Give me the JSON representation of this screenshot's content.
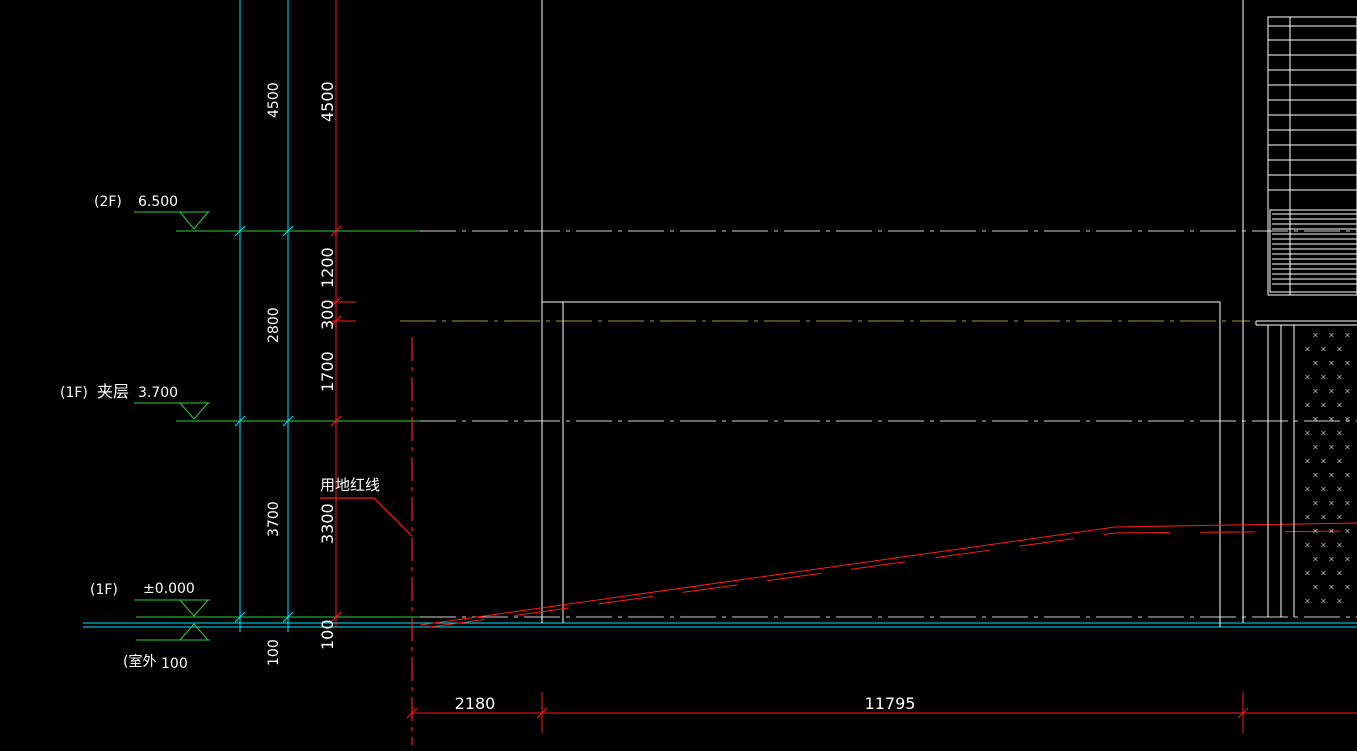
{
  "colors": {
    "background": "#000000",
    "white": "#ffffff",
    "cyan": "#00e5ff",
    "green": "#2ecc40",
    "red": "#ff1a1a",
    "olive": "#9a9a3a"
  },
  "levels": {
    "level_2f": {
      "tag": "(2F)",
      "elevation": "6.500"
    },
    "level_1f_mezzanine": {
      "tag": "(1F)",
      "name": "夹层",
      "elevation": "3.700"
    },
    "level_1f": {
      "tag": "(1F)",
      "elevation": "±0.000"
    },
    "outdoor": {
      "label": "(室外",
      "value": "100"
    }
  },
  "vertical_dims_cyan": {
    "top": "4500",
    "mid": "2800",
    "low": "3700",
    "base": "100"
  },
  "vertical_dims_red": {
    "top": "4500",
    "a": "1200",
    "b": "300",
    "c": "1700",
    "d": "3300",
    "base": "100"
  },
  "annotations": {
    "property_line": "用地红线"
  },
  "horizontal_dims": {
    "left": "2180",
    "right": "11795"
  }
}
